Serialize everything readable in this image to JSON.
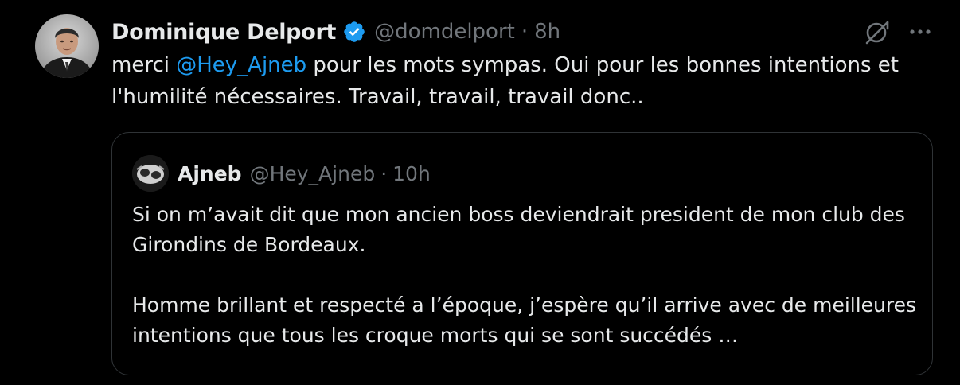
{
  "tweet": {
    "author_name": "Dominique Delport",
    "author_handle": "@domdelport",
    "separator": "·",
    "time": "8h",
    "text_before": "merci ",
    "mention": "@Hey_Ajneb",
    "text_after": " pour les mots sympas. Oui pour les bonnes intentions et l'humilité nécessaires. Travail, travail, travail donc..",
    "icons": {
      "verified": "verified-badge-icon",
      "grok": "grok-icon",
      "more": "more-icon"
    }
  },
  "quote": {
    "author_name": "Ajneb",
    "author_handle": "@Hey_Ajneb",
    "separator": "·",
    "time": "10h",
    "paragraph1": "Si on m’avait dit que mon ancien boss deviendrait president de mon club des Girondins de Bordeaux.",
    "paragraph2": "Homme brillant et respecté a l’époque, j’espère qu’il arrive avec de meilleures intentions que tous les croque morts qui se sont succédés …"
  },
  "colors": {
    "background": "#000000",
    "text": "#e7e9ea",
    "secondary": "#71767b",
    "accent": "#1d9bf0",
    "border": "#2f3336"
  }
}
